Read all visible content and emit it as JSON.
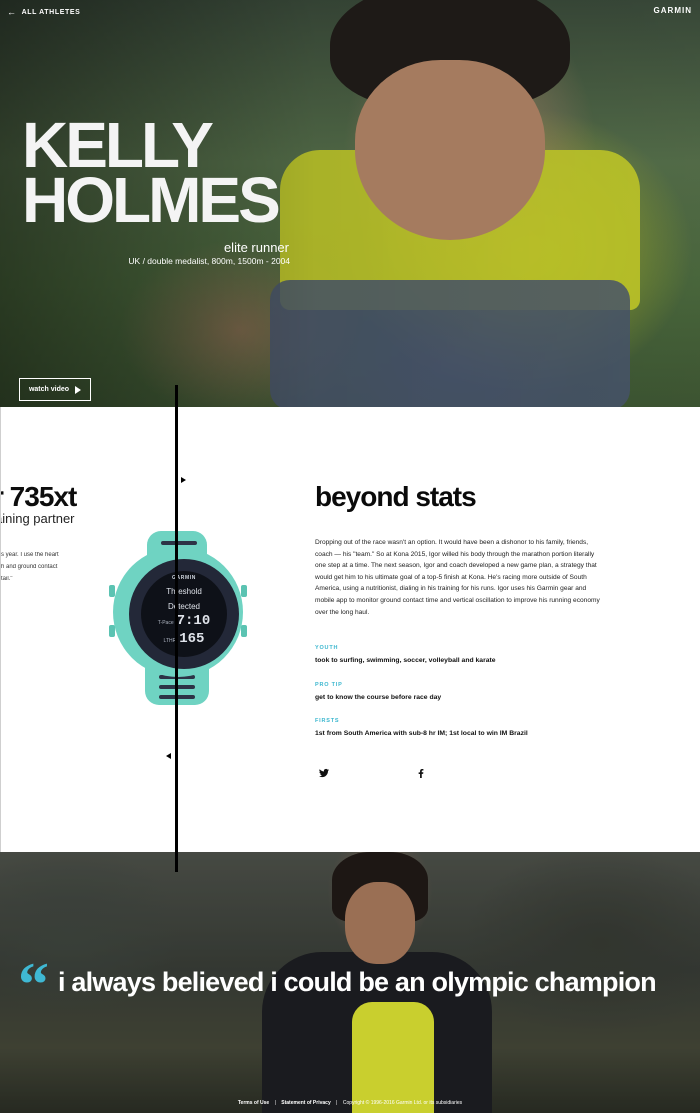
{
  "header": {
    "back_label": "ALL ATHLETES",
    "brand": "GARMIN"
  },
  "hero": {
    "name_line1": "KELLY",
    "name_line2": "HOLMES",
    "role": "elite runner",
    "credentials": "UK / double medalist, 800m, 1500m - 2004",
    "watch_video_label": "watch video"
  },
  "product": {
    "title": "r 735xt",
    "subtitle": "aining partner",
    "quote_lines": [
      "s year. I use the heart",
      "h and ground contact",
      "tail.\""
    ],
    "watch_screen": {
      "brand": "GARMIN",
      "line1": "Threshold",
      "line2": "Detected",
      "pace_label": "T-Pace",
      "pace_value": "7:10",
      "hr_label": "LTHR",
      "hr_value": "165"
    }
  },
  "story": {
    "title": "beyond stats",
    "body": "Dropping out of the race wasn't an option. It would have been a dishonor to his family, friends, coach — his \"team.\" So at Kona 2015, Igor willed his body through the marathon portion literally one step at a time. The next season, Igor and coach developed a new game plan, a strategy that would get him to his ultimate goal of a top-5 finish at Kona. He's racing more outside of South America, using a nutritionist, dialing in his training for his runs. Igor uses his Garmin gear and mobile app to monitor ground contact time and vertical oscillation to improve his running economy over the long haul.",
    "facts": [
      {
        "label": "YOUTH",
        "value": "took to surfing, swimming, soccer, volleyball and karate"
      },
      {
        "label": "PRO TIP",
        "value": "get to know the course before race day"
      },
      {
        "label": "FIRSTS",
        "value": "1st from South America with sub-8 hr IM; 1st local to win IM Brazil"
      }
    ]
  },
  "quote": {
    "mark": "“",
    "text": "i always believed i could be an olympic champion"
  },
  "footer": {
    "terms": "Terms of Use",
    "privacy": "Statement of Privacy",
    "copyright": "Copyright © 1996-2016 Garmin Ltd. or its subsidiaries",
    "separator": "|"
  },
  "colors": {
    "accent": "#3fb8d3",
    "watch_teal": "#6fd3c2",
    "tank_yellow": "#c8cf2a"
  }
}
